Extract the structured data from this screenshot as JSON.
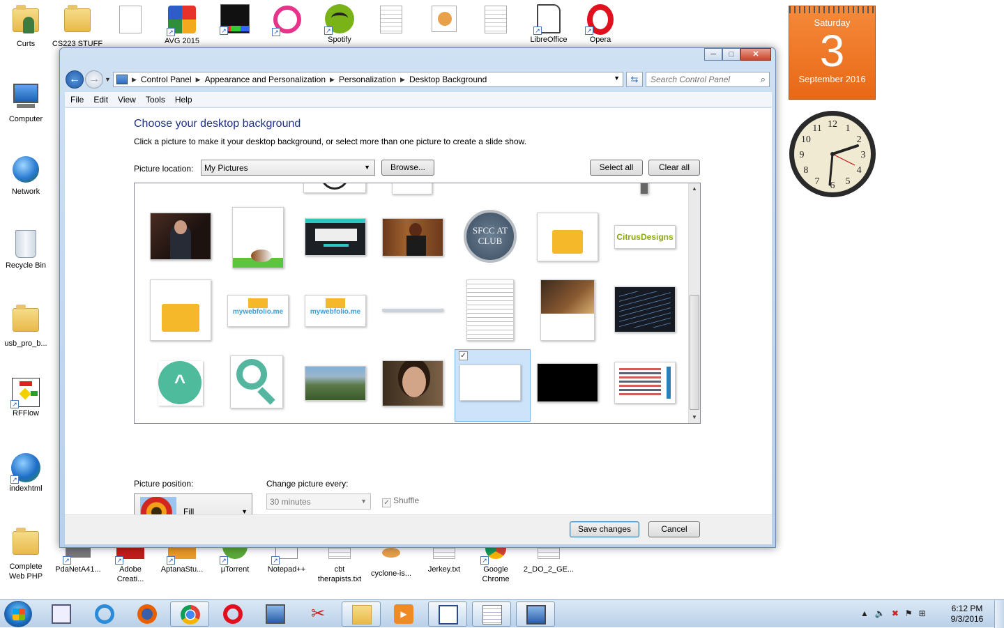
{
  "desktop": {
    "icons_left": [
      {
        "label": "Curts",
        "kind": "user"
      },
      {
        "label": "Computer",
        "kind": "computer"
      },
      {
        "label": "Network",
        "kind": "network"
      },
      {
        "label": "Recycle Bin",
        "kind": "recycle"
      },
      {
        "label": "usb_pro_b...",
        "kind": "folder"
      },
      {
        "label": "RFFlow",
        "kind": "flow"
      },
      {
        "label": "indexhtml",
        "kind": "globe"
      },
      {
        "label": "Complete\nWeb PHP",
        "kind": "folder"
      }
    ],
    "icons_top": [
      {
        "label": "CS223 STUFF",
        "kind": "folder"
      },
      {
        "label": "",
        "kind": "doc"
      },
      {
        "label": "AVG 2015",
        "kind": "avg"
      },
      {
        "label": "",
        "kind": "tetris"
      },
      {
        "label": "",
        "kind": "wamp"
      },
      {
        "label": "Spotify",
        "kind": "spotify"
      },
      {
        "label": "",
        "kind": "doc"
      },
      {
        "label": "",
        "kind": "pig"
      },
      {
        "label": "",
        "kind": "doc"
      },
      {
        "label": "LibreOffice",
        "kind": "libre"
      },
      {
        "label": "Opera",
        "kind": "opera"
      }
    ],
    "icons_bottom": [
      {
        "label": "PdaNetA41...",
        "kind": "app"
      },
      {
        "label": "Adobe\nCreati...",
        "kind": "adobe"
      },
      {
        "label": "AptanaStu...",
        "kind": "aptana"
      },
      {
        "label": "µTorrent",
        "kind": "torrent"
      },
      {
        "label": "Notepad++",
        "kind": "notepad"
      },
      {
        "label": "cbt\ntherapists.txt",
        "kind": "doc"
      },
      {
        "label": "cyclone-is...",
        "kind": "pig"
      },
      {
        "label": "Jerkey.txt",
        "kind": "doc"
      },
      {
        "label": "Google\nChrome",
        "kind": "chrome"
      },
      {
        "label": "2_DO_2_GE...",
        "kind": "doc"
      }
    ]
  },
  "gadgets": {
    "calendar": {
      "weekday": "Saturday",
      "day": "3",
      "month_year": "September 2016"
    },
    "clock": {
      "numerals": [
        "12",
        "1",
        "2",
        "3",
        "4",
        "5",
        "6",
        "7",
        "8",
        "9",
        "10",
        "11"
      ]
    }
  },
  "window": {
    "caption_buttons": {
      "minimize": "─",
      "maximize": "□",
      "close": "✕"
    },
    "nav": {
      "back": "←",
      "forward": "→"
    },
    "breadcrumb": [
      "Control Panel",
      "Appearance and Personalization",
      "Personalization",
      "Desktop Background"
    ],
    "search_placeholder": "Search Control Panel",
    "menu": [
      "File",
      "Edit",
      "View",
      "Tools",
      "Help"
    ],
    "title": "Choose your desktop background",
    "subtitle": "Click a picture to make it your desktop background, or select more than one picture to create a slide show.",
    "picture_location_label": "Picture location:",
    "picture_location_value": "My Pictures",
    "browse_label": "Browse...",
    "select_all_label": "Select all",
    "clear_all_label": "Clear all",
    "thumbnails": [
      {
        "name": "man-in-suit",
        "text": ""
      },
      {
        "name": "guinea-pig",
        "text": ""
      },
      {
        "name": "dark-webpage",
        "text": ""
      },
      {
        "name": "woman-tv-show",
        "text": ""
      },
      {
        "name": "sfcc-at-club-badge",
        "text": "SFCC AT CLUB"
      },
      {
        "name": "folder-logo",
        "text": ""
      },
      {
        "name": "citrus-designs-logo",
        "text": "CitrusDesigns"
      },
      {
        "name": "folder-logo-large",
        "text": ""
      },
      {
        "name": "mywebfolio-logo",
        "text": "mywebfolio.me"
      },
      {
        "name": "mywebfolio-logo-2",
        "text": "mywebfolio.me"
      },
      {
        "name": "thin-line-graphic",
        "text": ""
      },
      {
        "name": "resume-document",
        "text": ""
      },
      {
        "name": "hotel-flyer",
        "text": ""
      },
      {
        "name": "code-screenshot",
        "text": ""
      },
      {
        "name": "up-arrow-circle",
        "text": ""
      },
      {
        "name": "magnifier-graphic",
        "text": ""
      },
      {
        "name": "city-aerial",
        "text": ""
      },
      {
        "name": "woman-portrait",
        "text": ""
      },
      {
        "name": "blank-white",
        "text": "",
        "selected": true
      },
      {
        "name": "black-image",
        "text": ""
      },
      {
        "name": "chart-graphic",
        "text": ""
      }
    ],
    "picture_position_label": "Picture position:",
    "picture_position_value": "Fill",
    "change_every_label": "Change picture every:",
    "change_every_value": "30 minutes",
    "shuffle_label": "Shuffle",
    "shuffle_checked": true,
    "save_label": "Save changes",
    "cancel_label": "Cancel"
  },
  "taskbar": {
    "apps": [
      "calculator",
      "internet-explorer",
      "firefox",
      "chrome",
      "opera",
      "run-tool",
      "snipping-tool",
      "file-explorer",
      "media-player",
      "rfflow",
      "notepad",
      "control-panel"
    ],
    "time": "6:12 PM",
    "date": "9/3/2016"
  },
  "colors": {
    "title_blue": "#1e3287",
    "calendar_orange": "#e86816",
    "selection_blue": "#cde3fa"
  }
}
